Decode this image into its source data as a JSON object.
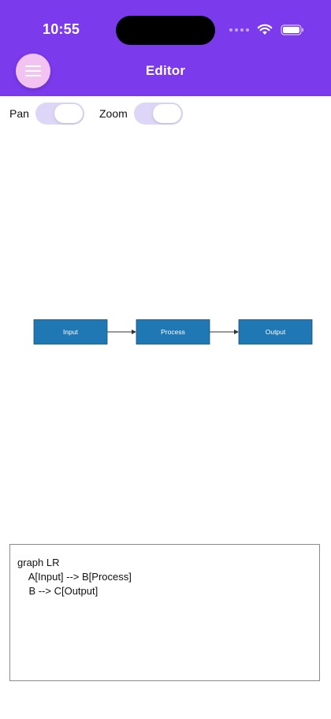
{
  "status_bar": {
    "time": "10:55"
  },
  "app_bar": {
    "title": "Editor",
    "menu_icon": "hamburger-icon",
    "accent_color": "#7c3aed"
  },
  "toggles": [
    {
      "label": "Pan",
      "on": true
    },
    {
      "label": "Zoom",
      "on": true
    }
  ],
  "diagram": {
    "type": "flowchart",
    "direction": "LR",
    "node_color": "#1f77b4",
    "nodes": [
      {
        "id": "A",
        "label": "Input"
      },
      {
        "id": "B",
        "label": "Process"
      },
      {
        "id": "C",
        "label": "Output"
      }
    ],
    "edges": [
      {
        "from": "A",
        "to": "B"
      },
      {
        "from": "B",
        "to": "C"
      }
    ]
  },
  "editor": {
    "lines": [
      "graph LR",
      "    A[Input] --> B[Process]",
      "    B --> C[Output]"
    ]
  }
}
